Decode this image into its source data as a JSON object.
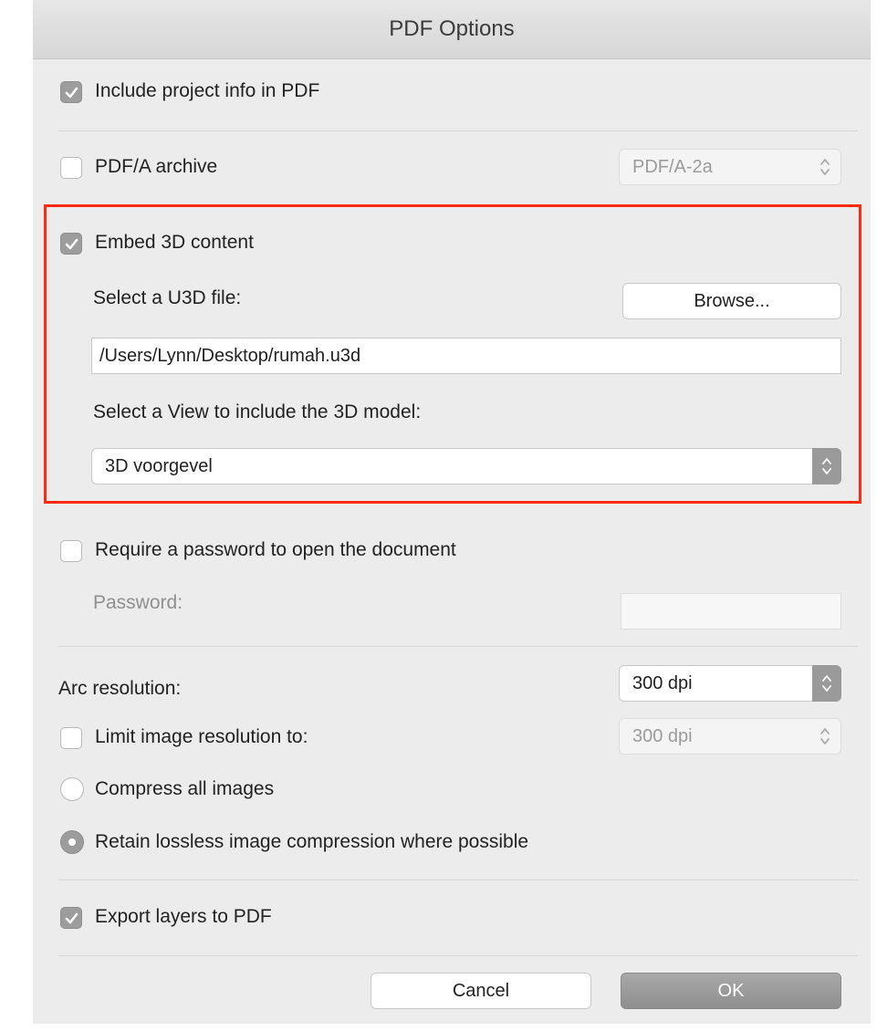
{
  "dialog": {
    "title": "PDF Options"
  },
  "project_info": {
    "label": "Include project info in PDF",
    "checked": true
  },
  "pdfa": {
    "label": "PDF/A archive",
    "checked": false,
    "select_value": "PDF/A-2a"
  },
  "embed3d": {
    "label": "Embed 3D content",
    "checked": true,
    "select_file_label": "Select a U3D file:",
    "browse_label": "Browse...",
    "file_path": "/Users/Lynn/Desktop/rumah.u3d",
    "select_view_label": "Select a View to include the 3D model:",
    "view_value": "3D voorgevel"
  },
  "password": {
    "label": "Require a password to open the document",
    "checked": false,
    "field_label": "Password:",
    "field_value": ""
  },
  "resolution": {
    "arc_label": "Arc resolution:",
    "arc_value": "300 dpi",
    "limit_label": "Limit image resolution to:",
    "limit_checked": false,
    "limit_value": "300 dpi"
  },
  "compression": {
    "compress_all_label": "Compress all images",
    "retain_lossless_label": "Retain lossless image compression where possible",
    "selected": "retain_lossless"
  },
  "layers": {
    "label": "Export layers to PDF",
    "checked": true
  },
  "buttons": {
    "cancel": "Cancel",
    "ok": "OK"
  },
  "colors": {
    "highlight": "#ff2a12",
    "checked_fill": "#9d9d9d",
    "dialog_bg": "#ececec"
  }
}
